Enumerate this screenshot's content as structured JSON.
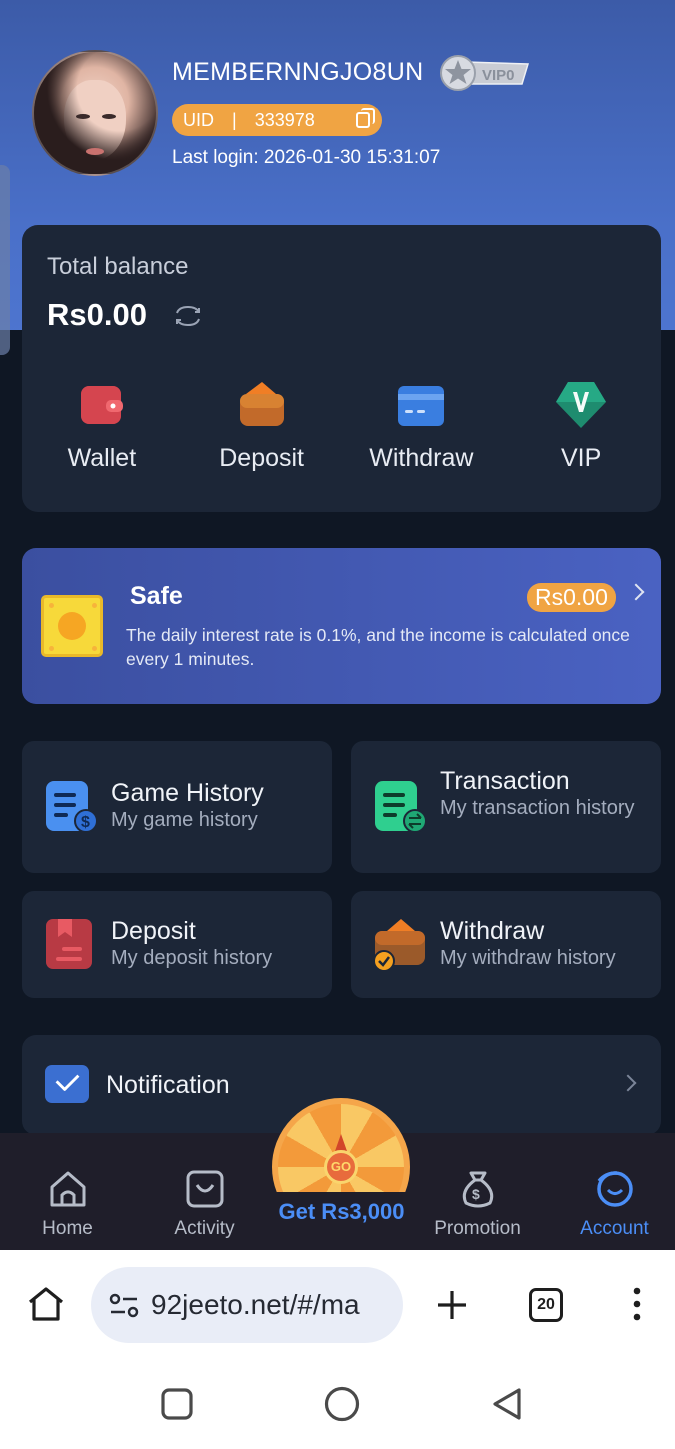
{
  "profile": {
    "username": "MEMBERNNGJO8UN",
    "vip_badge": "VIP0",
    "uid_label": "UID",
    "uid_sep": "|",
    "uid_value": "333978",
    "last_login": "Last login: 2026-01-30 15:31:07"
  },
  "balance": {
    "label": "Total balance",
    "amount": "Rs0.00",
    "actions": [
      {
        "label": "Wallet",
        "icon": "wallet-icon"
      },
      {
        "label": "Deposit",
        "icon": "deposit-icon"
      },
      {
        "label": "Withdraw",
        "icon": "withdraw-icon"
      },
      {
        "label": "VIP",
        "icon": "vip-icon"
      }
    ]
  },
  "safe": {
    "title": "Safe",
    "amount": "Rs0.00",
    "description": "The daily interest rate is 0.1%, and the income is calculated once every 1 minutes."
  },
  "history": [
    {
      "title": "Game History",
      "subtitle": "My game history"
    },
    {
      "title": "Transaction",
      "subtitle": "My transaction history"
    },
    {
      "title": "Deposit",
      "subtitle": "My deposit history"
    },
    {
      "title": "Withdraw",
      "subtitle": "My withdraw history"
    }
  ],
  "notification": {
    "label": "Notification"
  },
  "nav": {
    "home": "Home",
    "activity": "Activity",
    "promo_wheel": "GO",
    "promo_get": "Get Rs3,000",
    "promotion": "Promotion",
    "account": "Account"
  },
  "browser": {
    "url": "92jeeto.net/#/ma",
    "tabs_count": "20"
  },
  "colors": {
    "accent": "#4b8ef6",
    "orange": "#f0a443",
    "card": "#1c2637",
    "background": "#0f1724"
  }
}
